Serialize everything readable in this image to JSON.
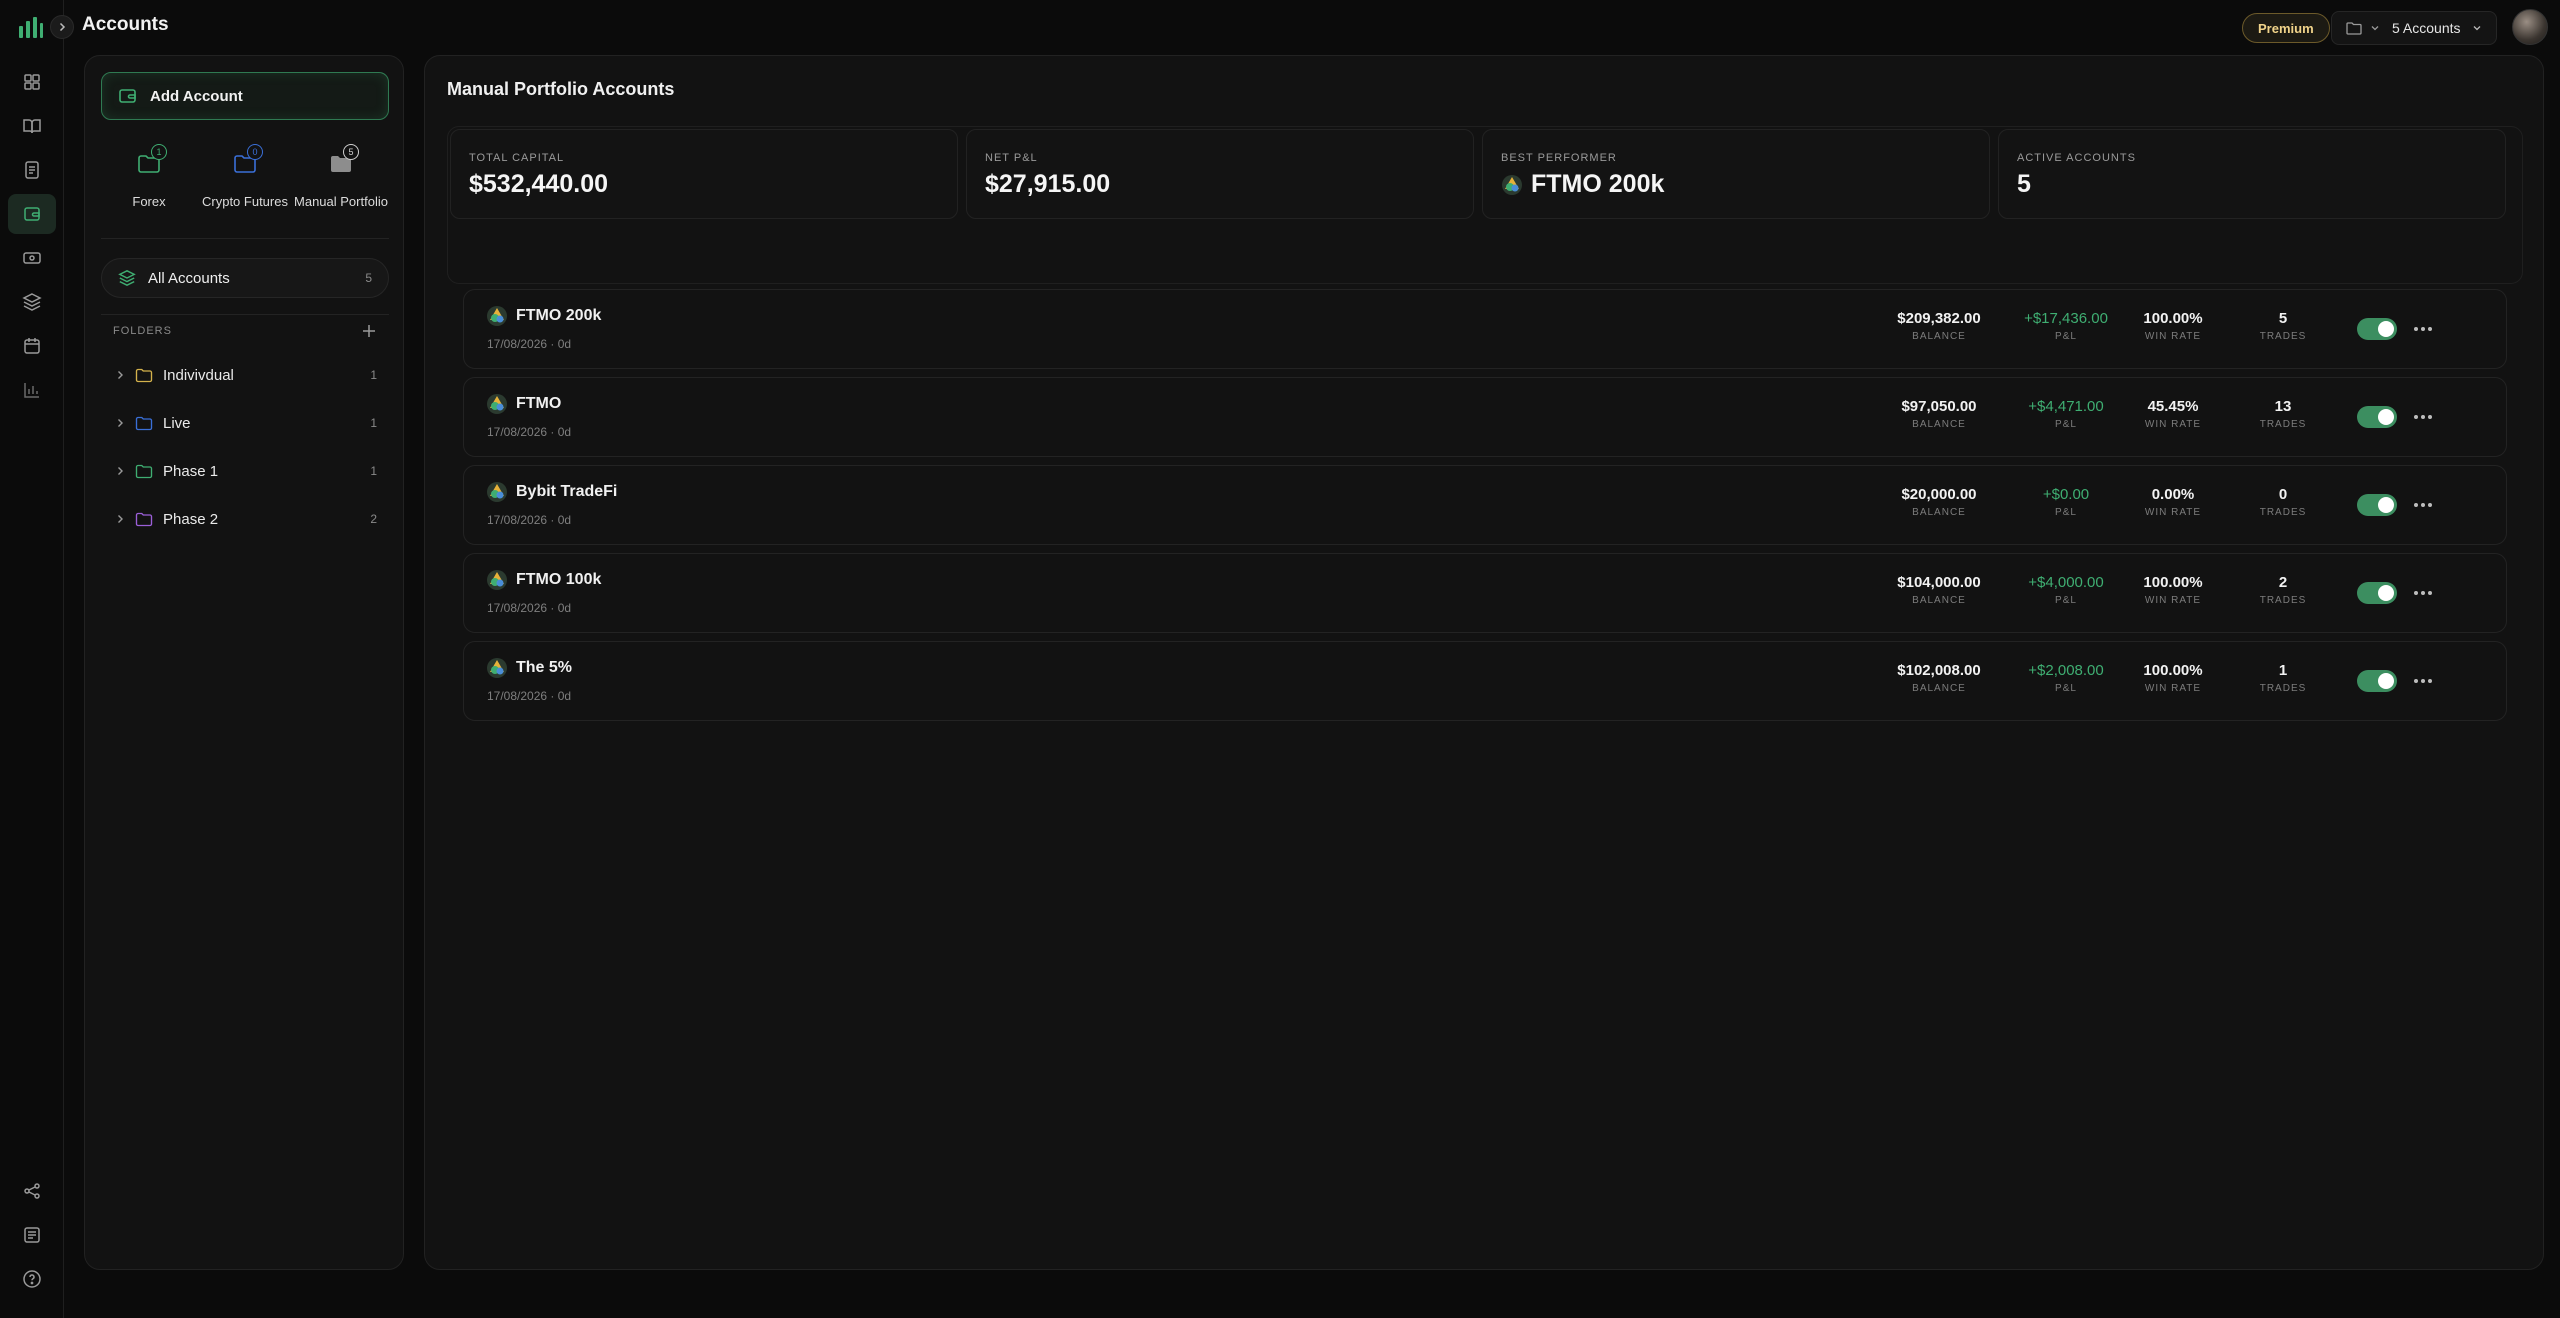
{
  "header": {
    "title": "Accounts",
    "premium": "Premium",
    "account_selector": "5 Accounts"
  },
  "sidebar": {
    "add_account": "Add Account",
    "categories": [
      {
        "label": "Forex",
        "count": "1",
        "color": "#3fae72"
      },
      {
        "label": "Crypto Futures",
        "count": "0",
        "color": "#3a6fd8"
      },
      {
        "label": "Manual Portfolio",
        "count": "5",
        "color": "#9a9a9a"
      }
    ],
    "all_accounts": {
      "label": "All Accounts",
      "count": "5"
    },
    "folders_label": "FOLDERS",
    "folders": [
      {
        "name": "Indivivdual",
        "count": "1",
        "color": "#d4b24c"
      },
      {
        "name": "Live",
        "count": "1",
        "color": "#3a6fd8"
      },
      {
        "name": "Phase 1",
        "count": "1",
        "color": "#3fae72"
      },
      {
        "name": "Phase 2",
        "count": "2",
        "color": "#9b5fd8"
      }
    ]
  },
  "main": {
    "title": "Manual Portfolio Accounts",
    "stats": [
      {
        "label": "TOTAL CAPITAL",
        "value": "$532,440.00"
      },
      {
        "label": "NET P&L",
        "value": "$27,915.00"
      },
      {
        "label": "BEST PERFORMER",
        "value": "FTMO 200k"
      },
      {
        "label": "ACTIVE ACCOUNTS",
        "value": "5"
      }
    ],
    "metric_labels": {
      "balance": "BALANCE",
      "pnl": "P&L",
      "win_rate": "WIN RATE",
      "trades": "TRADES"
    },
    "accounts": [
      {
        "name": "FTMO 200k",
        "date": "17/08/2026 · 0d",
        "balance": "$209,382.00",
        "pnl": "+$17,436.00",
        "win_rate": "100.00%",
        "trades": "5",
        "enabled": true
      },
      {
        "name": "FTMO",
        "date": "17/08/2026 · 0d",
        "balance": "$97,050.00",
        "pnl": "+$4,471.00",
        "win_rate": "45.45%",
        "trades": "13",
        "enabled": true
      },
      {
        "name": "Bybit TradeFi",
        "date": "17/08/2026 · 0d",
        "balance": "$20,000.00",
        "pnl": "+$0.00",
        "win_rate": "0.00%",
        "trades": "0",
        "enabled": true
      },
      {
        "name": "FTMO 100k",
        "date": "17/08/2026 · 0d",
        "balance": "$104,000.00",
        "pnl": "+$4,000.00",
        "win_rate": "100.00%",
        "trades": "2",
        "enabled": true
      },
      {
        "name": "The 5%",
        "date": "17/08/2026 · 0d",
        "balance": "$102,008.00",
        "pnl": "+$2,008.00",
        "win_rate": "100.00%",
        "trades": "1",
        "enabled": true
      }
    ]
  },
  "colors": {
    "accent": "#3fae72",
    "background": "#0b0b0b",
    "panel": "#121212"
  }
}
